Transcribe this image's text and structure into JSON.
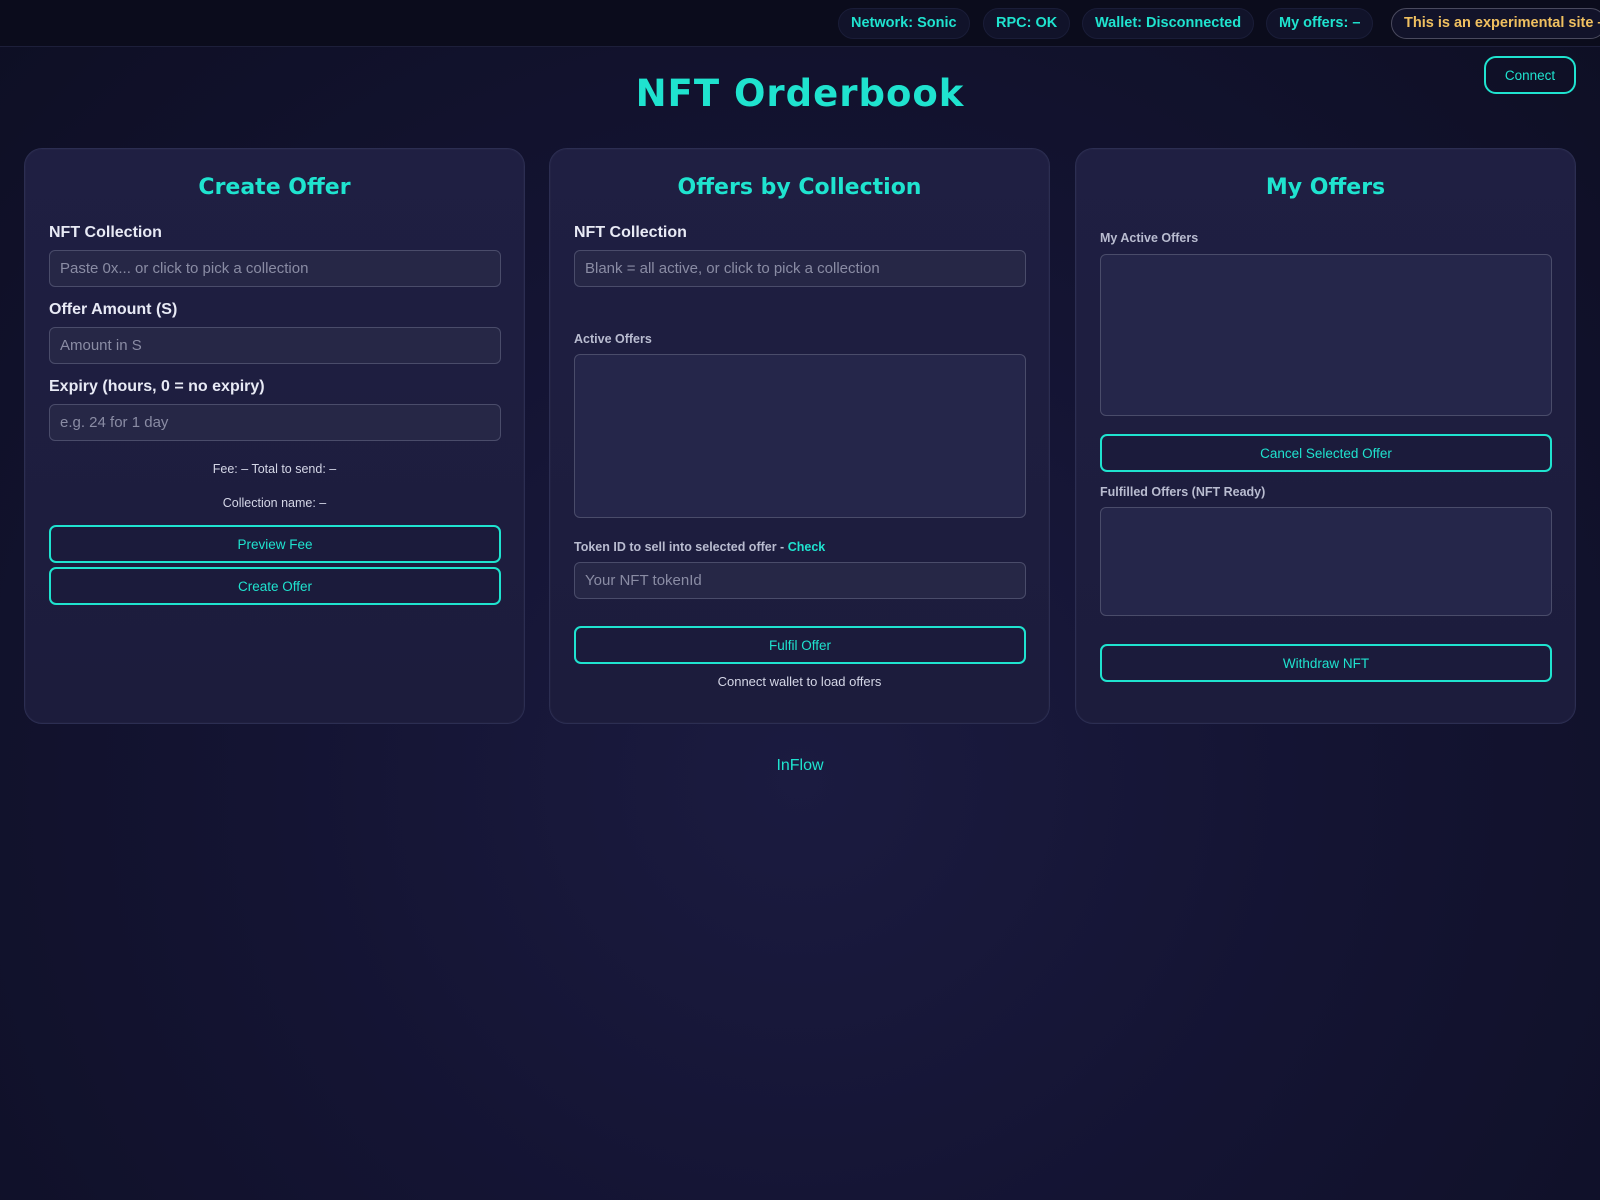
{
  "status_bar": {
    "network": "Network: Sonic",
    "rpc": "RPC: OK",
    "wallet": "Wallet: Disconnected",
    "my_offers": "My offers: –",
    "warning": "This is an experimental site –"
  },
  "header": {
    "title": "NFT Orderbook",
    "connect_label": "Connect"
  },
  "create_offer": {
    "title": "Create Offer",
    "collection_label": "NFT Collection",
    "collection_placeholder": "Paste 0x... or click to pick a collection",
    "amount_label": "Offer Amount (S)",
    "amount_placeholder": "Amount in S",
    "expiry_label": "Expiry (hours, 0 = no expiry)",
    "expiry_placeholder": "e.g. 24 for 1 day",
    "fee_text": "Fee: – Total to send: –",
    "collection_name_text": "Collection name: –",
    "preview_fee_label": "Preview Fee",
    "create_offer_label": "Create Offer"
  },
  "offers_by_collection": {
    "title": "Offers by Collection",
    "collection_label": "NFT Collection",
    "collection_placeholder": "Blank = all active, or click to pick a collection",
    "active_offers_label": "Active Offers",
    "token_label": "Token ID to sell into selected offer -",
    "check_link": "Check",
    "token_placeholder": "Your NFT tokenId",
    "fulfil_label": "Fulfil Offer",
    "status_text": "Connect wallet to load offers"
  },
  "my_offers": {
    "title": "My Offers",
    "active_label": "My Active Offers",
    "cancel_label": "Cancel Selected Offer",
    "fulfilled_label": "Fulfilled Offers (NFT Ready)",
    "withdraw_label": "Withdraw NFT"
  },
  "footer": {
    "link": "InFlow"
  },
  "colors": {
    "accent": "#1fe3cf",
    "warning": "#f0c060",
    "background": "#141433",
    "panel": "#1e1e40"
  }
}
